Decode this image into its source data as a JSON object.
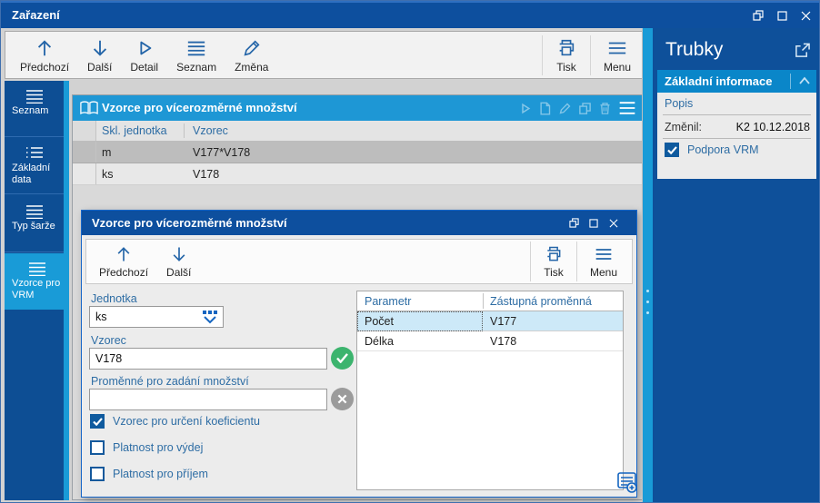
{
  "window": {
    "title": "Zařazení"
  },
  "colors": {
    "titlebar_blue": "#0d4f9e",
    "accent_blue": "#199bd7",
    "list_header_blue": "#1e97d5",
    "section_header_blue": "#0a86c9",
    "label_blue": "#2e6da4",
    "success_green": "#3cb46e",
    "muted_gray": "#9b9b9b"
  },
  "toolbar": {
    "items": [
      {
        "label": "Předchozí",
        "icon": "arrow-up-icon"
      },
      {
        "label": "Další",
        "icon": "arrow-down-icon"
      },
      {
        "label": "Detail",
        "icon": "play-icon"
      },
      {
        "label": "Seznam",
        "icon": "list-icon"
      },
      {
        "label": "Změna",
        "icon": "pencil-icon"
      }
    ],
    "print_label": "Tisk",
    "menu_label": "Menu"
  },
  "sidebar": {
    "items": [
      {
        "label": "Seznam",
        "active": false
      },
      {
        "label": "Základní data",
        "active": false
      },
      {
        "label": "Typ šarže",
        "active": false
      },
      {
        "label": "Vzorce pro VRM",
        "active": true
      }
    ]
  },
  "main_list": {
    "title": "Vzorce pro vícerozměrné množství",
    "columns": [
      "Skl. jednotka",
      "Vzorec"
    ],
    "rows": [
      {
        "unit": "m",
        "formula": "V177*V178",
        "selected": true
      },
      {
        "unit": "ks",
        "formula": "V178",
        "selected": false
      }
    ]
  },
  "dialog": {
    "title": "Vzorce pro vícerozměrné množství",
    "toolbar": {
      "prev": "Předchozí",
      "next": "Další",
      "print": "Tisk",
      "menu": "Menu"
    },
    "fields": {
      "unit_label": "Jednotka",
      "unit_value": "ks",
      "formula_label": "Vzorec",
      "formula_value": "V178",
      "variables_label": "Proměnné pro zadání množství",
      "variables_value": ""
    },
    "checkboxes": [
      {
        "label": "Vzorec pro určení koeficientu",
        "checked": true
      },
      {
        "label": "Platnost pro výdej",
        "checked": false
      },
      {
        "label": "Platnost pro příjem",
        "checked": false
      }
    ],
    "param_table": {
      "columns": [
        "Parametr",
        "Zástupná proměnná"
      ],
      "rows": [
        {
          "param": "Počet",
          "variable": "V177",
          "selected": true
        },
        {
          "param": "Délka",
          "variable": "V178",
          "selected": false
        }
      ]
    }
  },
  "side_panel": {
    "title": "Trubky",
    "section_title": "Základní informace",
    "popis_label": "Popis",
    "zmenil_label": "Změnil:",
    "zmenil_value": "K2 10.12.2018",
    "checkbox_label": "Podpora VRM",
    "checkbox_checked": true
  }
}
